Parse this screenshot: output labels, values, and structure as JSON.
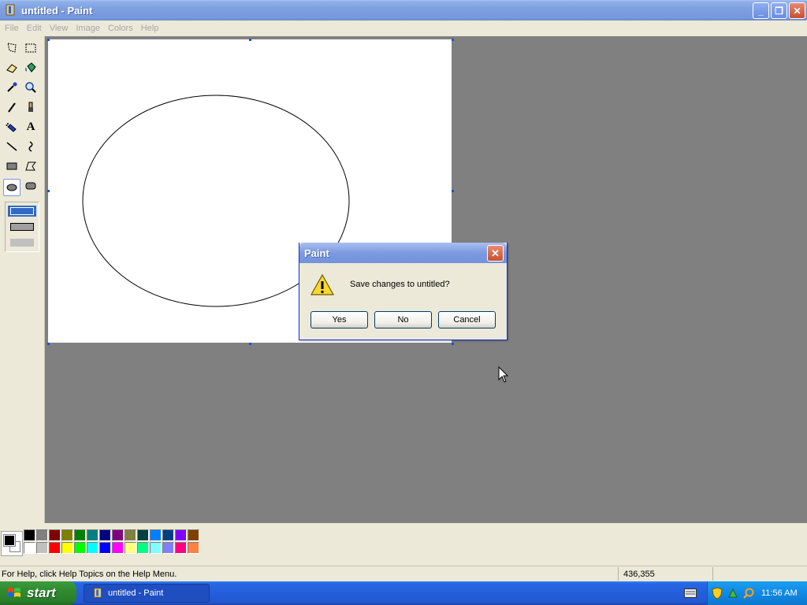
{
  "window": {
    "title": "untitled - Paint",
    "app_icon": "paint-brush-icon"
  },
  "window_buttons": {
    "minimize": "_",
    "maximize": "❐",
    "close": "✕"
  },
  "menu": [
    "File",
    "Edit",
    "View",
    "Image",
    "Colors",
    "Help"
  ],
  "toolbox": {
    "tools": [
      "free-form-select-icon",
      "rect-select-icon",
      "eraser-icon",
      "fill-bucket-icon",
      "pick-color-icon",
      "magnifier-icon",
      "pencil-icon",
      "brush-icon",
      "airbrush-icon",
      "text-icon",
      "line-icon",
      "curve-icon",
      "rectangle-icon",
      "polygon-icon",
      "ellipse-icon",
      "rounded-rect-icon"
    ],
    "selected_tool": "ellipse-icon",
    "text_tool_label": "A"
  },
  "palette": {
    "foreground": "#000000",
    "background": "#ffffff",
    "row1": [
      "#000000",
      "#808080",
      "#800000",
      "#808000",
      "#008000",
      "#008080",
      "#000080",
      "#800080",
      "#808040",
      "#004040",
      "#0080ff",
      "#004080",
      "#8000ff",
      "#804000"
    ],
    "row2": [
      "#ffffff",
      "#c0c0c0",
      "#ff0000",
      "#ffff00",
      "#00ff00",
      "#00ffff",
      "#0000ff",
      "#ff00ff",
      "#ffff80",
      "#00ff80",
      "#80ffff",
      "#8080ff",
      "#ff0080",
      "#ff8040"
    ]
  },
  "status": {
    "help_text": "For Help, click Help Topics on the Help Menu.",
    "coords": "436,355"
  },
  "dialog": {
    "title": "Paint",
    "message": "Save changes to untitled?",
    "buttons": {
      "yes": "Yes",
      "no": "No",
      "cancel": "Cancel"
    },
    "icon": "warning-icon"
  },
  "taskbar": {
    "start_label": "start",
    "task_item": "untitled - Paint",
    "clock": "11:56 AM",
    "tray_icons": [
      "security-shield-icon",
      "network-icon",
      "search-icon"
    ]
  }
}
